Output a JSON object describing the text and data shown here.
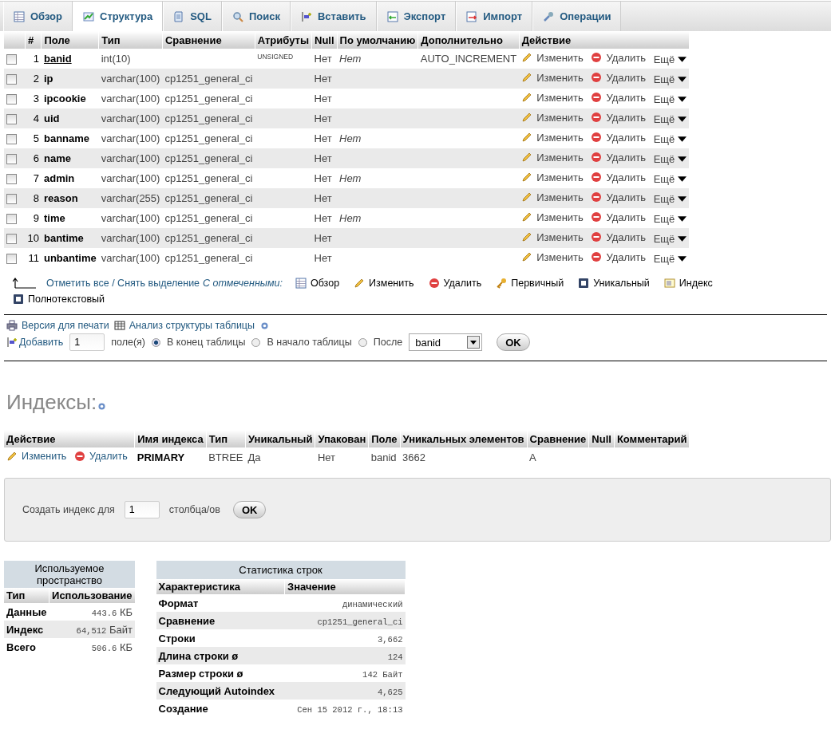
{
  "tabs": [
    {
      "label": "Обзор",
      "kind": "browse",
      "selected": false
    },
    {
      "label": "Структура",
      "kind": "structure",
      "selected": true
    },
    {
      "label": "SQL",
      "kind": "sql",
      "selected": false
    },
    {
      "label": "Поиск",
      "kind": "search",
      "selected": false
    },
    {
      "label": "Вставить",
      "kind": "insert",
      "selected": false
    },
    {
      "label": "Экспорт",
      "kind": "export",
      "selected": false
    },
    {
      "label": "Импорт",
      "kind": "import",
      "selected": false
    },
    {
      "label": "Операции",
      "kind": "operations",
      "selected": false
    }
  ],
  "structure": {
    "columns": [
      "#",
      "Поле",
      "Тип",
      "Сравнение",
      "Атрибуты",
      "Null",
      "По умолчанию",
      "Дополнительно",
      "Действие"
    ],
    "rows": [
      {
        "num": "1",
        "name": "banid",
        "primary": true,
        "type": "int(10)",
        "collation": "",
        "attributes": "UNSIGNED",
        "null": "Нет",
        "default": "Нет",
        "extra": "AUTO_INCREMENT",
        "checked": false,
        "actions": [
          "Изменить",
          "Удалить",
          "Ещё"
        ]
      },
      {
        "num": "2",
        "name": "ip",
        "primary": false,
        "type": "varchar(100)",
        "collation": "cp1251_general_ci",
        "attributes": "",
        "null": "Нет",
        "default": "",
        "extra": "",
        "checked": false,
        "actions": [
          "Изменить",
          "Удалить",
          "Ещё"
        ]
      },
      {
        "num": "3",
        "name": "ipcookie",
        "primary": false,
        "type": "varchar(100)",
        "collation": "cp1251_general_ci",
        "attributes": "",
        "null": "Нет",
        "default": "",
        "extra": "",
        "checked": false,
        "actions": [
          "Изменить",
          "Удалить",
          "Ещё"
        ]
      },
      {
        "num": "4",
        "name": "uid",
        "primary": false,
        "type": "varchar(100)",
        "collation": "cp1251_general_ci",
        "attributes": "",
        "null": "Нет",
        "default": "",
        "extra": "",
        "checked": false,
        "actions": [
          "Изменить",
          "Удалить",
          "Ещё"
        ]
      },
      {
        "num": "5",
        "name": "banname",
        "primary": false,
        "type": "varchar(100)",
        "collation": "cp1251_general_ci",
        "attributes": "",
        "null": "Нет",
        "default": "Нет",
        "extra": "",
        "checked": false,
        "actions": [
          "Изменить",
          "Удалить",
          "Ещё"
        ]
      },
      {
        "num": "6",
        "name": "name",
        "primary": false,
        "type": "varchar(100)",
        "collation": "cp1251_general_ci",
        "attributes": "",
        "null": "Нет",
        "default": "",
        "extra": "",
        "checked": false,
        "actions": [
          "Изменить",
          "Удалить",
          "Ещё"
        ]
      },
      {
        "num": "7",
        "name": "admin",
        "primary": false,
        "type": "varchar(100)",
        "collation": "cp1251_general_ci",
        "attributes": "",
        "null": "Нет",
        "default": "Нет",
        "extra": "",
        "checked": false,
        "actions": [
          "Изменить",
          "Удалить",
          "Ещё"
        ]
      },
      {
        "num": "8",
        "name": "reason",
        "primary": false,
        "type": "varchar(255)",
        "collation": "cp1251_general_ci",
        "attributes": "",
        "null": "Нет",
        "default": "",
        "extra": "",
        "checked": false,
        "actions": [
          "Изменить",
          "Удалить",
          "Ещё"
        ]
      },
      {
        "num": "9",
        "name": "time",
        "primary": false,
        "type": "varchar(100)",
        "collation": "cp1251_general_ci",
        "attributes": "",
        "null": "Нет",
        "default": "Нет",
        "extra": "",
        "checked": false,
        "actions": [
          "Изменить",
          "Удалить",
          "Ещё"
        ]
      },
      {
        "num": "10",
        "name": "bantime",
        "primary": false,
        "type": "varchar(100)",
        "collation": "cp1251_general_ci",
        "attributes": "",
        "null": "Нет",
        "default": "",
        "extra": "",
        "checked": false,
        "actions": [
          "Изменить",
          "Удалить",
          "Ещё"
        ]
      },
      {
        "num": "11",
        "name": "unbantime",
        "primary": false,
        "type": "varchar(100)",
        "collation": "cp1251_general_ci",
        "attributes": "",
        "null": "Нет",
        "default": "",
        "extra": "",
        "checked": false,
        "actions": [
          "Изменить",
          "Удалить",
          "Ещё"
        ]
      }
    ]
  },
  "bulk": {
    "check_all": "Отметить все / Снять выделение",
    "with_selected": "С отмеченными:",
    "buttons": [
      {
        "label": "Обзор",
        "kind": "browse"
      },
      {
        "label": "Изменить",
        "kind": "edit"
      },
      {
        "label": "Удалить",
        "kind": "delete"
      },
      {
        "label": "Первичный",
        "kind": "primary"
      },
      {
        "label": "Уникальный",
        "kind": "unique"
      },
      {
        "label": "Индекс",
        "kind": "index"
      },
      {
        "label": "Полнотекстовый",
        "kind": "fulltext"
      }
    ]
  },
  "links": [
    {
      "label": "Версия для печати",
      "kind": "print"
    },
    {
      "label": "Анализ структуры таблицы",
      "kind": "analyze"
    }
  ],
  "add_fields": {
    "label": "Добавить",
    "value": "1",
    "unit": "поле(я)",
    "positions": [
      {
        "label": "В конец таблицы",
        "selected": true
      },
      {
        "label": "В начало таблицы",
        "selected": false
      },
      {
        "label": "После",
        "selected": false
      }
    ],
    "after": "banid",
    "ok": "OK"
  },
  "indexes": {
    "title": "Индексы:",
    "columns": [
      "Действие",
      "Имя индекса",
      "Тип",
      "Уникальный",
      "Упакован",
      "Поле",
      "Уникальных элементов",
      "Сравнение",
      "Null",
      "Комментарий"
    ],
    "rows": [
      {
        "actions": [
          "Изменить",
          "Удалить"
        ],
        "name": "PRIMARY",
        "type": "BTREE",
        "unique": "Да",
        "packed": "Нет",
        "field": "banid",
        "cardinality": "3662",
        "collation": "A",
        "null": "",
        "comment": ""
      }
    ]
  },
  "create_index": {
    "label": "Создать индекс для",
    "value": "1",
    "unit": "столбца/ов",
    "ok": "OK"
  },
  "space": {
    "title": "Используемое пространство",
    "columns": [
      "Тип",
      "Использование"
    ],
    "rows": [
      {
        "type": "Данные",
        "value": "443.6",
        "unit": "КБ"
      },
      {
        "type": "Индекс",
        "value": "64,512",
        "unit": "Байт"
      },
      {
        "type": "Всего",
        "value": "506.6",
        "unit": "КБ"
      }
    ]
  },
  "row_stats": {
    "title": "Статистика строк",
    "columns": [
      "Характеристика",
      "Значение"
    ],
    "rows": [
      {
        "name": "Формат",
        "value": "динамический"
      },
      {
        "name": "Сравнение",
        "value": "cp1251_general_ci"
      },
      {
        "name": "Строки",
        "value": "3,662"
      },
      {
        "name": "Длина строки ø",
        "value": "124"
      },
      {
        "name": "Размер строки ø",
        "value": "142 Байт"
      },
      {
        "name": "Следующий Autoindex",
        "value": "4,625"
      },
      {
        "name": "Создание",
        "value": "Сен 15 2012 г., 18:13"
      }
    ]
  }
}
